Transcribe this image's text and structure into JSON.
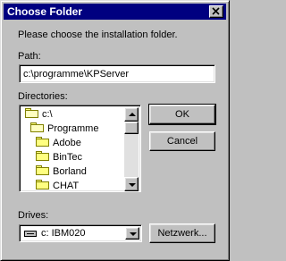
{
  "dialog": {
    "title": "Choose Folder",
    "instruction": "Please choose the installation folder."
  },
  "path": {
    "label": "Path:",
    "value": "c:\\programme\\KPServer"
  },
  "directories": {
    "label": "Directories:",
    "items": [
      {
        "label": "c:\\",
        "icon": "open-folder-icon"
      },
      {
        "label": "Programme",
        "icon": "open-folder-icon"
      },
      {
        "label": "Adobe",
        "icon": "folder-icon"
      },
      {
        "label": "BinTec",
        "icon": "folder-icon"
      },
      {
        "label": "Borland",
        "icon": "folder-icon"
      },
      {
        "label": "CHAT",
        "icon": "folder-icon"
      }
    ]
  },
  "drives": {
    "label": "Drives:",
    "selected": "c: IBM020"
  },
  "buttons": {
    "ok": "OK",
    "cancel": "Cancel",
    "network": "Netzwerk..."
  }
}
